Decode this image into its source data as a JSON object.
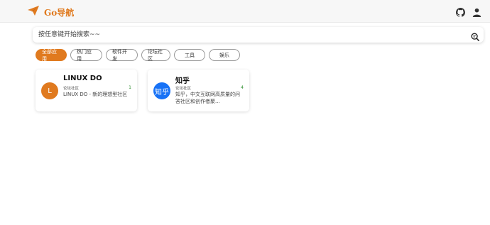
{
  "app": {
    "logo_text": "Go导航"
  },
  "search": {
    "placeholder": "按任意键开始搜索~~"
  },
  "tabs": [
    {
      "label": "全部应用",
      "active": true
    },
    {
      "label": "热门应用",
      "active": false
    },
    {
      "label": "软件开发",
      "active": false
    },
    {
      "label": "论坛社区",
      "active": false
    },
    {
      "label": "工具",
      "active": false
    },
    {
      "label": "娱乐",
      "active": false
    }
  ],
  "cards": [
    {
      "title": "LINUX DO",
      "avatar_text": "L",
      "avatar_color": "#e07a1f",
      "category": "论坛社区",
      "count": "1",
      "description": "LINUX DO - 新的理想型社区"
    },
    {
      "title": "知乎",
      "avatar_text": "知乎",
      "avatar_color": "#1772f6",
      "category": "论坛社区",
      "count": "4",
      "description": "知乎，中文互联网高质量的问答社区和创作者聚..."
    }
  ],
  "colors": {
    "accent": "#e07a1f",
    "count": "#2f8f2f"
  },
  "icons": {
    "logo": "paper-plane-icon",
    "github": "github-icon",
    "user": "user-icon",
    "search": "search-icon"
  }
}
